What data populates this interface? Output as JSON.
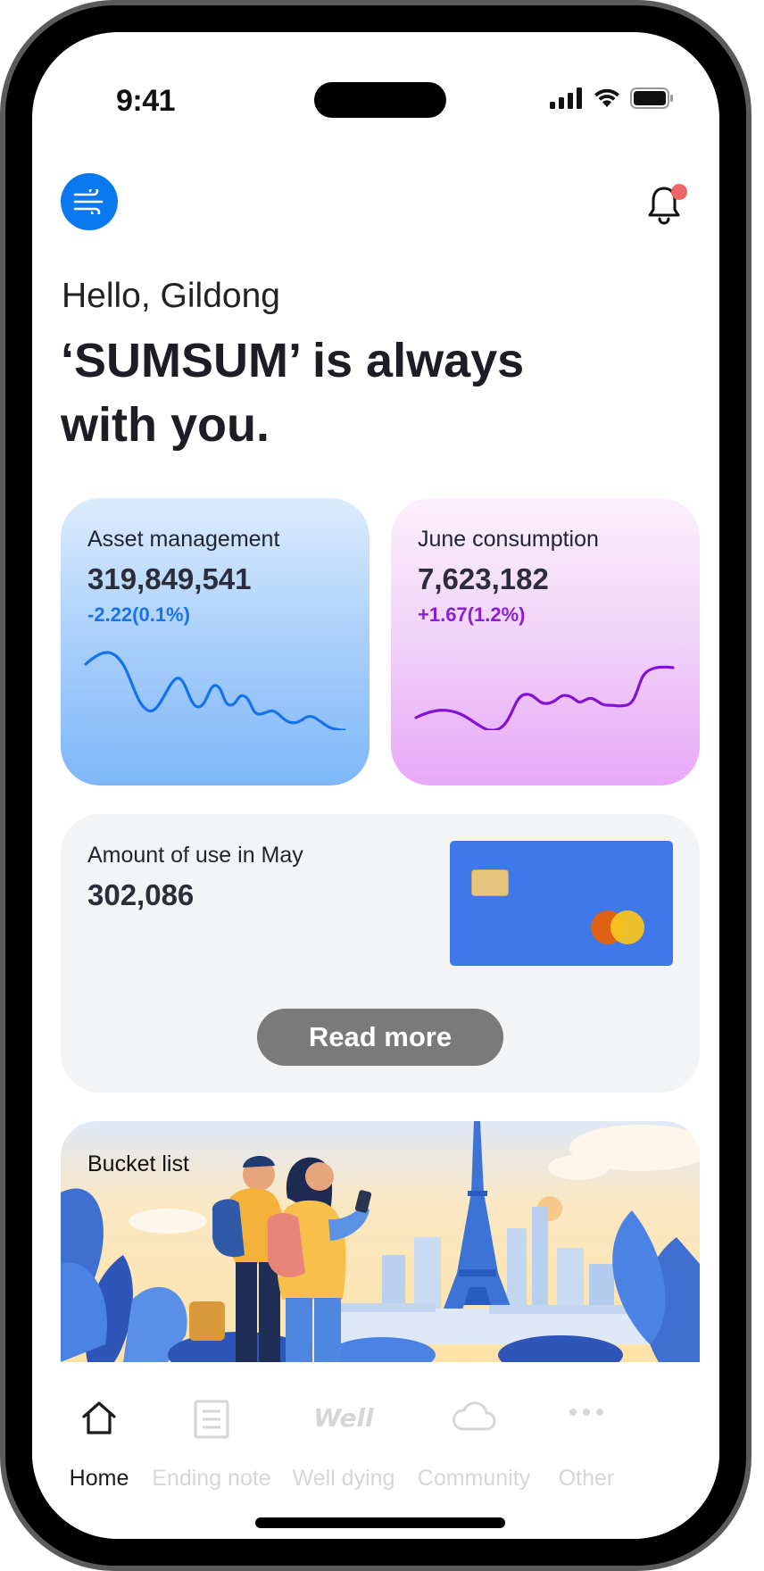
{
  "status_bar": {
    "time": "9:41"
  },
  "header": {
    "menu_icon": "wind-menu-icon",
    "notification_icon": "bell-icon",
    "has_unread": true
  },
  "greeting": "Hello, Gildong",
  "headline": "‘SUMSUM’ is always with you.",
  "cards": {
    "asset": {
      "label": "Asset management",
      "value": "319,849,541",
      "delta": "-2.22(0.1%)",
      "delta_color": "#1a73e8",
      "line_color": "#1572e8"
    },
    "june": {
      "label": "June consumption",
      "value": "7,623,182",
      "delta": "+1.67(1.2%)",
      "delta_color": "#8a1fd6",
      "line_color": "#8411d8"
    }
  },
  "amount": {
    "label": "Amount of use in May",
    "value": "302,086",
    "read_more": "Read more"
  },
  "bucket": {
    "label": "Bucket list"
  },
  "tabs": [
    {
      "label": "Home",
      "icon": "home-icon",
      "active": true
    },
    {
      "label": "Ending note",
      "icon": "note-icon",
      "active": false
    },
    {
      "label": "Well dying",
      "icon": "well-logo-icon",
      "active": false,
      "icon_text": "Well"
    },
    {
      "label": "Community",
      "icon": "cloud-icon",
      "active": false
    },
    {
      "label": "Other",
      "icon": "more-icon",
      "active": false
    }
  ],
  "colors": {
    "accent": "#0a79f0",
    "notification_dot": "#ef6464",
    "card_blue": "#3f78e8"
  }
}
